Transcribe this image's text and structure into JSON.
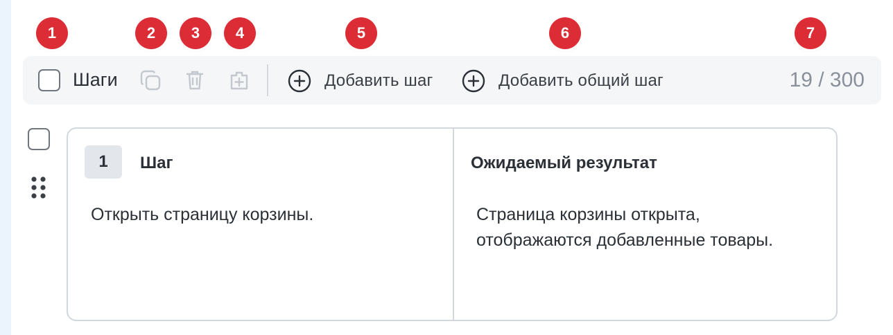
{
  "badges": [
    "1",
    "2",
    "3",
    "4",
    "5",
    "6",
    "7"
  ],
  "toolbar": {
    "title": "Шаги",
    "icons": [
      "copy-icon",
      "trash-icon",
      "add-shared-icon"
    ],
    "add_step_label": "Добавить шаг",
    "add_shared_step_label": "Добавить общий шаг",
    "counter": "19 / 300"
  },
  "step": {
    "number": "1",
    "step_header": "Шаг",
    "result_header": "Ожидаемый результат",
    "step_text": "Открыть страницу корзины.",
    "result_text": "Страница корзины открыта, отображаются добавленные товары."
  }
}
